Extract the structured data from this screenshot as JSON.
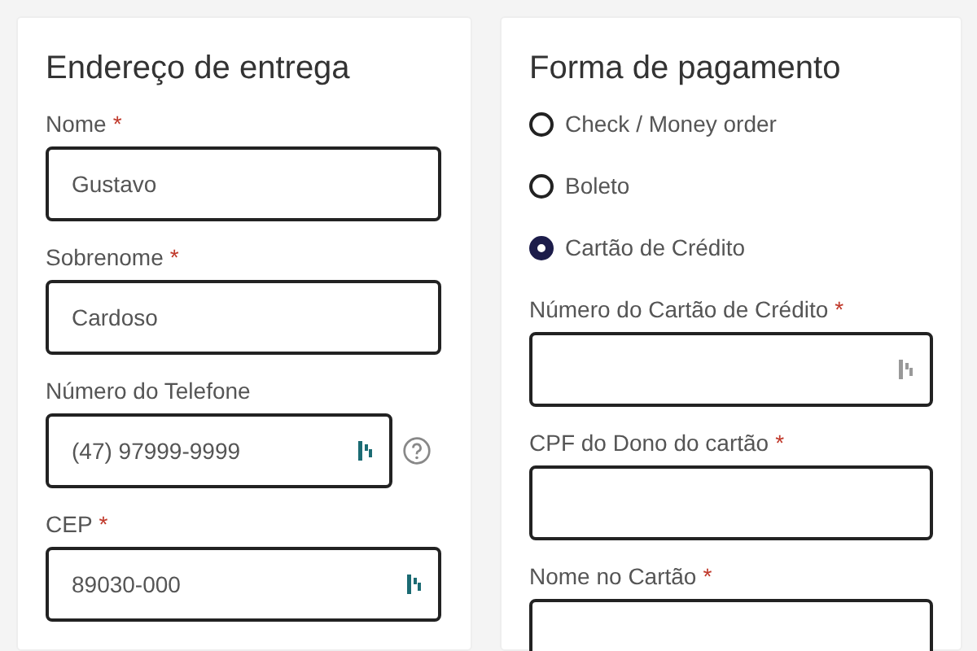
{
  "shipping": {
    "title": "Endereço de entrega",
    "fields": [
      {
        "label": "Nome",
        "required_mark": "*",
        "value": "Gustavo"
      },
      {
        "label": "Sobrenome",
        "required_mark": "*",
        "value": "Cardoso"
      },
      {
        "label": "Número do Telefone",
        "value": "(47) 97999-9999",
        "autofill_icon": true,
        "help": true
      },
      {
        "label": "CEP",
        "required_mark": "*",
        "value": "89030-000",
        "autofill_icon": true
      }
    ]
  },
  "payment": {
    "title": "Forma de pagamento",
    "methods": [
      {
        "label": "Check / Money order",
        "selected": false
      },
      {
        "label": "Boleto",
        "selected": false
      },
      {
        "label": "Cartão de Crédito",
        "selected": true
      }
    ],
    "fields": [
      {
        "label": "Número do Cartão de Crédito",
        "required_mark": "*",
        "autofill_icon": true
      },
      {
        "label": "CPF do Dono do cartão",
        "required_mark": "*"
      },
      {
        "label": "Nome no Cartão",
        "required_mark": "*"
      }
    ]
  }
}
